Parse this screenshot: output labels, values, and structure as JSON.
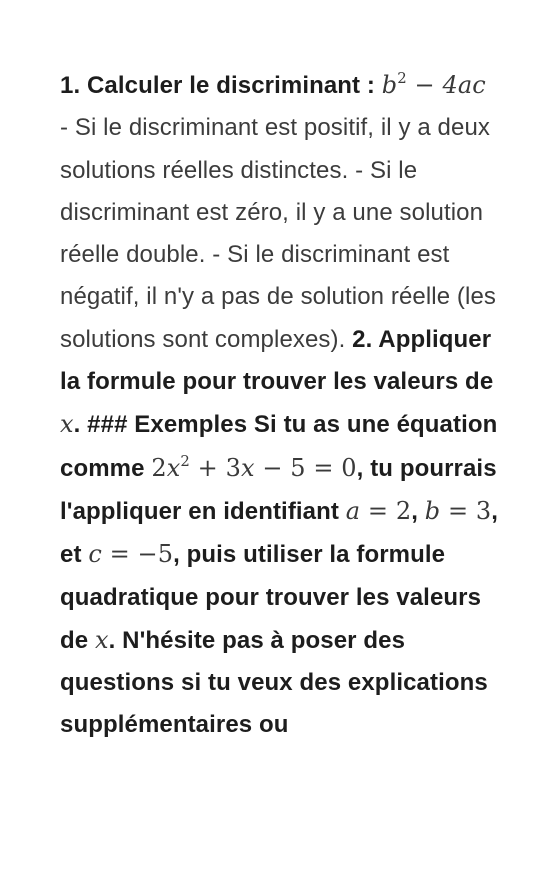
{
  "paragraph": {
    "step1_label": "1. Calculer le discriminant : ",
    "math_discriminant_b": "b",
    "math_discriminant_sq": "2",
    "math_discriminant_minus": " − ",
    "math_discriminant_4ac": "4ac",
    "discriminant_cases": " - Si le discriminant est positif, il y a deux solutions réelles distinctes. - Si le discriminant est zéro, il y a une solution réelle double. - Si le discriminant est négatif, il n'y a pas de solution réelle (les solutions sont complexes). ",
    "step2_text": "2. Appliquer la formule pour trouver les valeurs de ",
    "math_x1": "x",
    "examples_text": ". ### Exemples Si tu as une équation comme ",
    "math_eq_part1": "2",
    "math_eq_x": "x",
    "math_eq_sq": "2",
    "math_eq_part2": " + 3",
    "math_eq_x2": "x",
    "math_eq_part3": " − 5 = 0",
    "apply_text": ", tu pourrais l'appliquer en identifiant ",
    "math_a": "a",
    "math_a_val": " = 2",
    "sep1": ", ",
    "math_b": "b",
    "math_b_val": " = 3",
    "sep2": ", et ",
    "math_c": "c",
    "math_c_val": " = −5",
    "then_text": ", puis utiliser la formule quadratique pour trouver les valeurs de ",
    "math_x2": "x",
    "ending_text": ". N'hésite pas à poser des questions si tu veux des explications supplémentaires ou"
  }
}
